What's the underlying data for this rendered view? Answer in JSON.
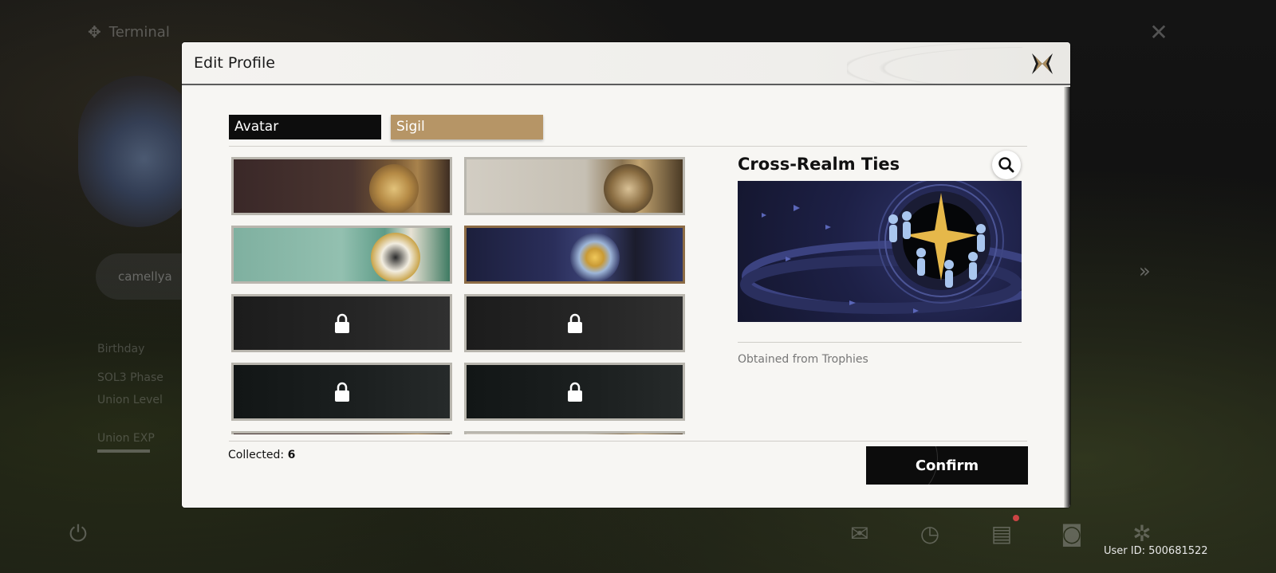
{
  "background": {
    "terminal_label": "Terminal",
    "username": "camellya",
    "stats": [
      "Birthday",
      "SOL3 Phase",
      "Union Level",
      "Union EXP"
    ],
    "user_id": "User ID: 500681522",
    "bottom_icons": [
      "power-icon",
      "mail-icon",
      "clock-icon",
      "notes-icon",
      "camera-icon",
      "settings-icon"
    ]
  },
  "modal": {
    "title": "Edit Profile",
    "tabs": [
      {
        "label": "Avatar",
        "active": false
      },
      {
        "label": "Sigil",
        "active": true
      }
    ],
    "sigils": [
      {
        "locked": false,
        "selected": false,
        "style": "s1"
      },
      {
        "locked": false,
        "selected": false,
        "style": "s2"
      },
      {
        "locked": false,
        "selected": false,
        "style": "s3"
      },
      {
        "locked": false,
        "selected": true,
        "style": "s4"
      },
      {
        "locked": true,
        "selected": false,
        "style": "s-locked"
      },
      {
        "locked": true,
        "selected": false,
        "style": "s-locked"
      },
      {
        "locked": true,
        "selected": false,
        "style": "s-locked2"
      },
      {
        "locked": true,
        "selected": false,
        "style": "s-locked2"
      }
    ],
    "collected_label": "Collected:",
    "collected_count": "6",
    "detail": {
      "title": "Cross-Realm Ties",
      "source": "Obtained from Trophies"
    },
    "confirm_label": "Confirm"
  },
  "colors": {
    "accent_tab": "#b69566",
    "dark": "#0c0c0c",
    "selected_border": "#8d6c45"
  }
}
